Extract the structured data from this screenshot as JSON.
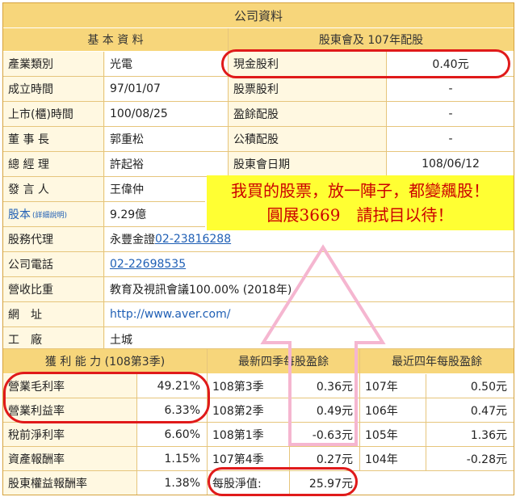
{
  "title": "公司資料",
  "basic": {
    "header": "基 本 資 料",
    "rows": [
      {
        "label": "產業類別",
        "value": "光電"
      },
      {
        "label": "成立時間",
        "value": "97/01/07"
      },
      {
        "label": "上市(櫃)時間",
        "value": "100/08/25"
      },
      {
        "label": "董 事 長",
        "value": "郭重松"
      },
      {
        "label": "總 經 理",
        "value": "許起裕"
      },
      {
        "label": "發 言 人",
        "value": "王偉仲"
      },
      {
        "label": "股本",
        "label_note": "(詳細說明)",
        "value": "9.29億"
      },
      {
        "label": "股務代理",
        "value": "永豐金證",
        "link": "02-23816288"
      },
      {
        "label": "公司電話",
        "link": "02-22698535"
      },
      {
        "label": "營收比重",
        "value": "教育及視訊會議100.00% (2018年)"
      },
      {
        "label": "網　址",
        "link": "http://www.aver.com/"
      },
      {
        "label": "工　廠",
        "value": "土城"
      }
    ]
  },
  "dividend": {
    "header": "股東會及 107年配股",
    "rows": [
      {
        "label": "現金股利",
        "value": "0.40元"
      },
      {
        "label": "股票股利",
        "value": "-"
      },
      {
        "label": "盈餘配股",
        "value": "-"
      },
      {
        "label": "公積配股",
        "value": "-"
      },
      {
        "label": "股東會日期",
        "value": "108/06/12"
      }
    ]
  },
  "note": {
    "line1": "我買的股票，放一陣子，都變飆股！",
    "line2": "圓展3669　請拭目以待！"
  },
  "profit": {
    "header": "獲 利 能 力 (108第3季)",
    "rows": [
      {
        "label": "營業毛利率",
        "value": "49.21%"
      },
      {
        "label": "營業利益率",
        "value": "6.33%"
      },
      {
        "label": "稅前淨利率",
        "value": "6.60%"
      },
      {
        "label": "資產報酬率",
        "value": "1.15%"
      },
      {
        "label": "股東權益報酬率",
        "value": "1.38%"
      }
    ]
  },
  "quarter_eps": {
    "header": "最新四季每股盈餘",
    "rows": [
      {
        "label": "108第3季",
        "value": "0.36元"
      },
      {
        "label": "108第2季",
        "value": "0.49元"
      },
      {
        "label": "108第1季",
        "value": "-0.63元"
      },
      {
        "label": "107第4季",
        "value": "0.27元"
      }
    ],
    "nav_label": "每股淨值:",
    "nav_value": "25.97元"
  },
  "year_eps": {
    "header": "最近四年每股盈餘",
    "rows": [
      {
        "label": "107年",
        "value": "0.50元"
      },
      {
        "label": "106年",
        "value": "0.47元"
      },
      {
        "label": "105年",
        "value": "1.36元"
      },
      {
        "label": "104年",
        "value": "-0.28元"
      }
    ]
  },
  "colors": {
    "header_bg": "#f7d67b",
    "label_bg": "#fff8e1",
    "highlight": "#e01a1a",
    "note_bg": "#ffff33",
    "link": "#1f5fb5"
  }
}
